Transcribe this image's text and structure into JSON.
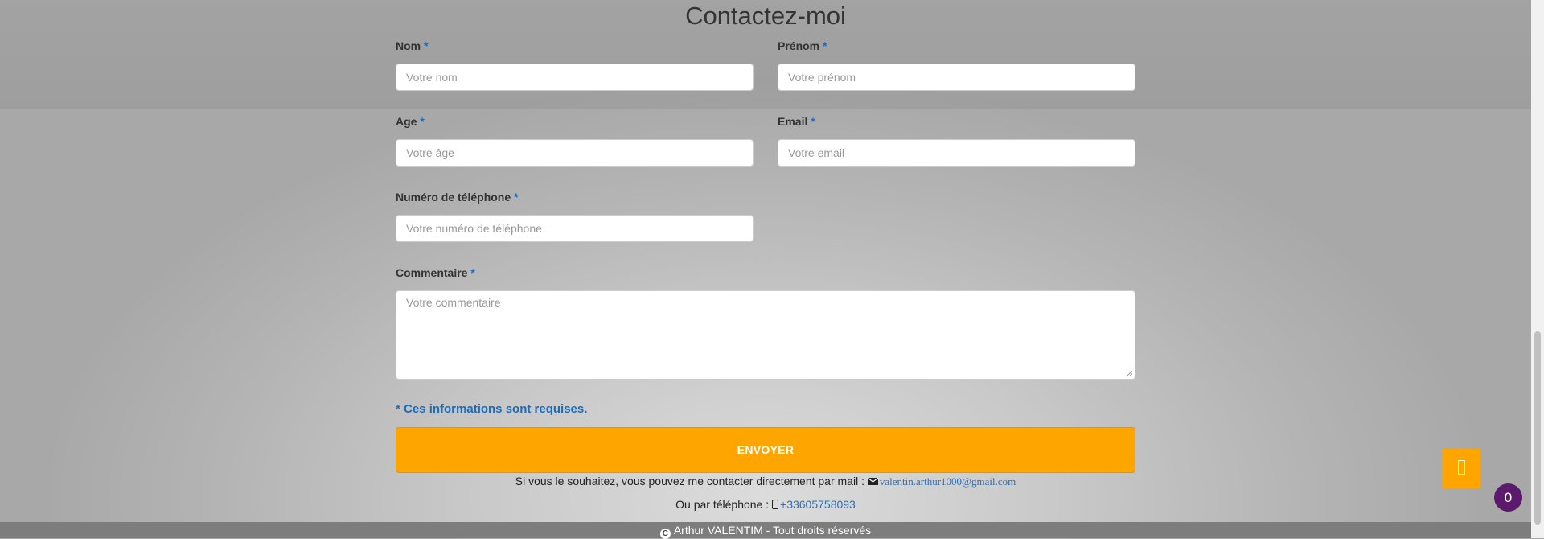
{
  "page": {
    "title": "Contactez-moi"
  },
  "form": {
    "required_mark": "*",
    "nom": {
      "label": "Nom",
      "placeholder": "Votre nom"
    },
    "prenom": {
      "label": "Prénom",
      "placeholder": "Votre prénom"
    },
    "age": {
      "label": "Age",
      "placeholder": "Votre âge"
    },
    "email": {
      "label": "Email",
      "placeholder": "Votre email"
    },
    "telephone": {
      "label": "Numéro de téléphone",
      "placeholder": "Votre numéro de téléphone"
    },
    "commentaire": {
      "label": "Commentaire",
      "placeholder": "Votre commentaire"
    },
    "required_note": "* Ces informations sont requises.",
    "submit_label": "ENVOYER"
  },
  "contact": {
    "mail_text": "Si vous le souhaitez, vous pouvez me contacter directement par mail :",
    "mail_address": "valentin.arthur1000@gmail.com",
    "phone_text": "Ou par téléphone :",
    "phone_number": "+33605758093"
  },
  "footer": {
    "copyright_symbol": "C",
    "text": "Arthur VALENTIM - Tout droits réservés"
  },
  "widgets": {
    "badge_count": "0",
    "scroll_top_icon": "arrow-up-icon"
  },
  "colors": {
    "accent": "#ffa500",
    "link": "#1e6bb8",
    "badge": "#5b1a6b",
    "footer": "#7d7d7d"
  }
}
